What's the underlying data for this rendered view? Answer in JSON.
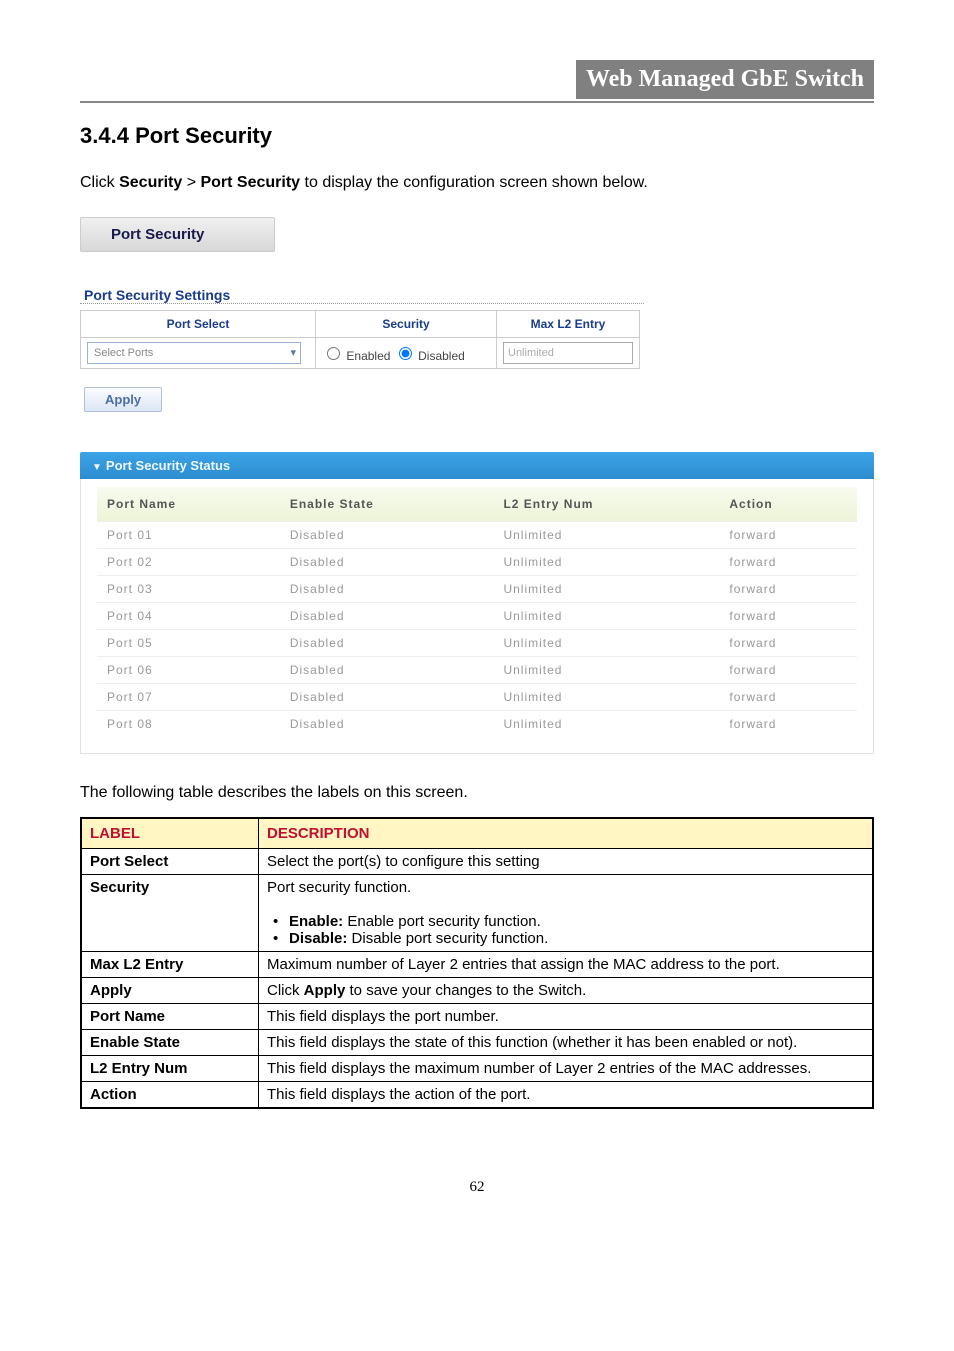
{
  "header": {
    "title": "Web Managed GbE Switch"
  },
  "section": {
    "number": "3.4.4",
    "title": "Port Security",
    "intro_prefix": "Click ",
    "intro_bold1": "Security",
    "intro_sep": " > ",
    "intro_bold2": "Port Security",
    "intro_suffix": " to display the configuration screen shown below."
  },
  "screenshot": {
    "tab_title": "Port Security",
    "settings_title": "Port Security Settings",
    "headers": {
      "port_select": "Port Select",
      "security": "Security",
      "max_l2": "Max L2 Entry"
    },
    "port_select_placeholder": "Select Ports",
    "radio_enabled": "Enabled",
    "radio_disabled": "Disabled",
    "max_l2_placeholder": "Unlimited",
    "apply_label": "Apply",
    "status_title": "Port Security Status",
    "status_headers": {
      "port_name": "Port Name",
      "enable_state": "Enable State",
      "l2_entry": "L2 Entry Num",
      "action": "Action"
    },
    "status_rows": [
      {
        "port": "Port 01",
        "state": "Disabled",
        "entry": "Unlimited",
        "action": "forward"
      },
      {
        "port": "Port 02",
        "state": "Disabled",
        "entry": "Unlimited",
        "action": "forward"
      },
      {
        "port": "Port 03",
        "state": "Disabled",
        "entry": "Unlimited",
        "action": "forward"
      },
      {
        "port": "Port 04",
        "state": "Disabled",
        "entry": "Unlimited",
        "action": "forward"
      },
      {
        "port": "Port 05",
        "state": "Disabled",
        "entry": "Unlimited",
        "action": "forward"
      },
      {
        "port": "Port 06",
        "state": "Disabled",
        "entry": "Unlimited",
        "action": "forward"
      },
      {
        "port": "Port 07",
        "state": "Disabled",
        "entry": "Unlimited",
        "action": "forward"
      },
      {
        "port": "Port 08",
        "state": "Disabled",
        "entry": "Unlimited",
        "action": "forward"
      }
    ]
  },
  "desc_intro": "The following table describes the labels on this screen.",
  "desc_table": {
    "header_label": "LABEL",
    "header_desc": "DESCRIPTION",
    "rows": {
      "port_select": {
        "label": "Port Select",
        "desc": "Select the port(s) to configure this setting"
      },
      "security": {
        "label": "Security",
        "line1": "Port security function.",
        "enable_bold": "Enable:",
        "enable_txt": " Enable port security function.",
        "disable_bold": "Disable:",
        "disable_txt": " Disable port security function."
      },
      "max_l2": {
        "label": "Max L2 Entry",
        "desc": "Maximum number of Layer 2 entries that assign the MAC address to the port."
      },
      "apply": {
        "label": "Apply",
        "prefix": "Click ",
        "bold": "Apply",
        "suffix": " to save your changes to the Switch."
      },
      "port_name": {
        "label": "Port Name",
        "desc": "This field displays the port number."
      },
      "enable_state": {
        "label": "Enable State",
        "desc": "This field displays the state of this function (whether it has been enabled or not)."
      },
      "l2_entry": {
        "label": "L2 Entry Num",
        "desc": "This field displays the maximum number of Layer 2 entries of the MAC addresses."
      },
      "action": {
        "label": "Action",
        "desc": "This field displays the action of the port."
      }
    }
  },
  "page_number": "62"
}
